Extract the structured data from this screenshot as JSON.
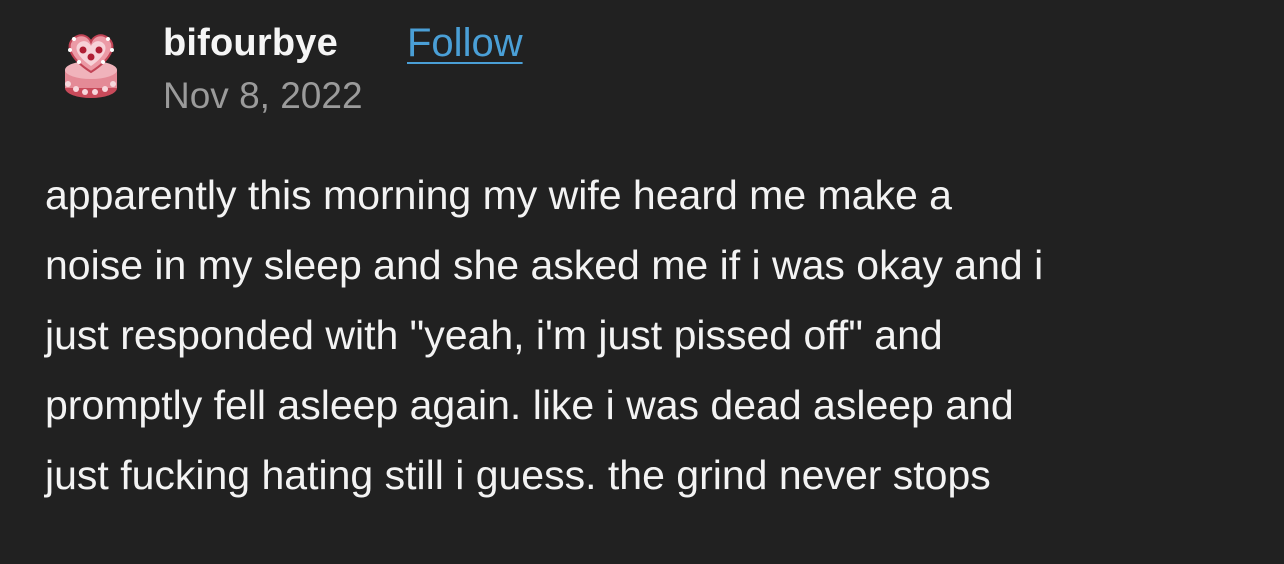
{
  "post": {
    "username": "bifourbye",
    "follow_label": "Follow",
    "date": "Nov 8, 2022",
    "avatar_icon": "heart-cake-avatar-icon",
    "body_lines": [
      "apparently this morning my wife heard me make a",
      "noise in my sleep and she asked me if i was okay and i",
      "just responded with \"yeah, i'm just pissed off\" and",
      "promptly fell asleep again. like i was dead asleep and",
      "just fucking hating still i guess. the grind never stops"
    ]
  },
  "colors": {
    "background": "#212121",
    "text": "#f3f3f3",
    "date": "#9b9b9b",
    "link": "#4a9fd6"
  }
}
